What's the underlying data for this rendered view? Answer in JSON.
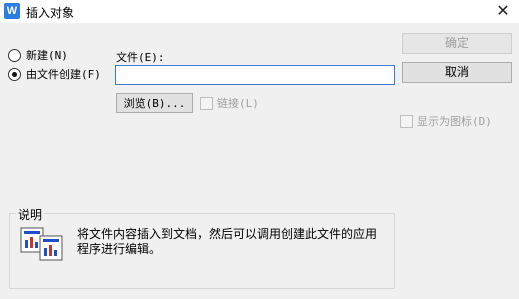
{
  "window": {
    "title": "插入对象",
    "app_icon_letter": "W"
  },
  "options": {
    "new_label": "新建(N)",
    "from_file_label": "由文件创建(F)",
    "selected": "from_file"
  },
  "file": {
    "label": "文件(E):",
    "value": ""
  },
  "buttons": {
    "ok": "确定",
    "cancel": "取消",
    "browse": "浏览(B)..."
  },
  "checkboxes": {
    "link": "链接(L)",
    "display_as_icon": "显示为图标(D)"
  },
  "description": {
    "title": "说明",
    "text": "将文件内容插入到文档，然后可以调用创建此文件的应用程序进行编辑。"
  }
}
